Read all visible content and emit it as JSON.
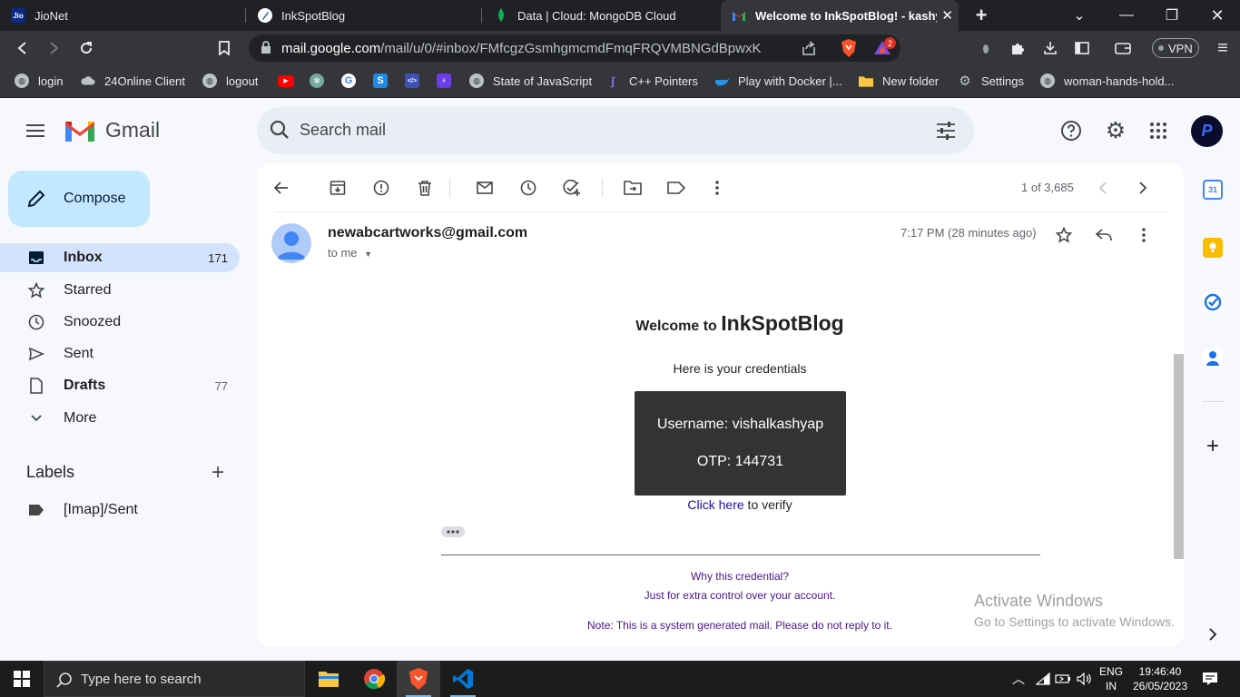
{
  "browser": {
    "tabs": [
      {
        "title": "JioNet",
        "favicon": "Jio"
      },
      {
        "title": "InkSpotBlog",
        "favicon": "ink"
      },
      {
        "title": "Data | Cloud: MongoDB Cloud",
        "favicon": "leaf"
      },
      {
        "title": "Welcome to InkSpotBlog! - kashy",
        "favicon": "M"
      }
    ],
    "url": {
      "host": "mail.google.com",
      "path": "/mail/u/0/#inbox/FMfcgzGsmhgmcmdFmqFRQVMBNGdBpwxK"
    },
    "brave_badge": "2",
    "vpn_label": "VPN",
    "bookmarks": [
      {
        "label": "login"
      },
      {
        "label": "24Online Client"
      },
      {
        "label": "logout"
      },
      {
        "label": "State of JavaScript"
      },
      {
        "label": "C++ Pointers"
      },
      {
        "label": "Play with Docker |..."
      },
      {
        "label": "New folder"
      },
      {
        "label": "Settings"
      },
      {
        "label": "woman-hands-hold..."
      }
    ]
  },
  "gmail": {
    "logo_text": "Gmail",
    "search_placeholder": "Search mail",
    "compose_label": "Compose",
    "nav": [
      {
        "label": "Inbox",
        "count": "171",
        "icon": "inbox-icon",
        "selected": true
      },
      {
        "label": "Starred",
        "count": "",
        "icon": "star-icon"
      },
      {
        "label": "Snoozed",
        "count": "",
        "icon": "clock-icon"
      },
      {
        "label": "Sent",
        "count": "",
        "icon": "send-icon"
      },
      {
        "label": "Drafts",
        "count": "77",
        "icon": "draft-icon"
      },
      {
        "label": "More",
        "count": "",
        "icon": "chevron-down-icon"
      }
    ],
    "labels_heading": "Labels",
    "labels": [
      {
        "label": "[Imap]/Sent"
      }
    ],
    "pagination": "1 of 3,685",
    "avatar_letter": "P"
  },
  "email": {
    "sender": "newabcartworks@gmail.com",
    "recipient_line": "to me",
    "time": "7:17 PM (28 minutes ago)",
    "heading_prefix": "Welcome to",
    "heading_brand": "InkSpotBlog",
    "intro": "Here is your credentials",
    "username_line": "Username: vishalkashyap",
    "otp_line": "OTP: 144731",
    "verify_link": "Click here",
    "verify_suffix": " to verify",
    "why_title": "Why this credential?",
    "why_text": "Just for extra control over your account.",
    "note": "Note: This is a system generated mail. Please do not reply to it."
  },
  "watermark": {
    "title": "Activate Windows",
    "subtitle": "Go to Settings to activate Windows."
  },
  "taskbar": {
    "search_placeholder": "Type here to search",
    "lang_top": "ENG",
    "lang_bottom": "IN",
    "time": "19:46:40",
    "date": "26/05/2023"
  },
  "colors": {
    "gmail_red": "#ea4335",
    "link": "#1a0dab",
    "credential_box": "#333333",
    "why_text": "#4a148c"
  }
}
